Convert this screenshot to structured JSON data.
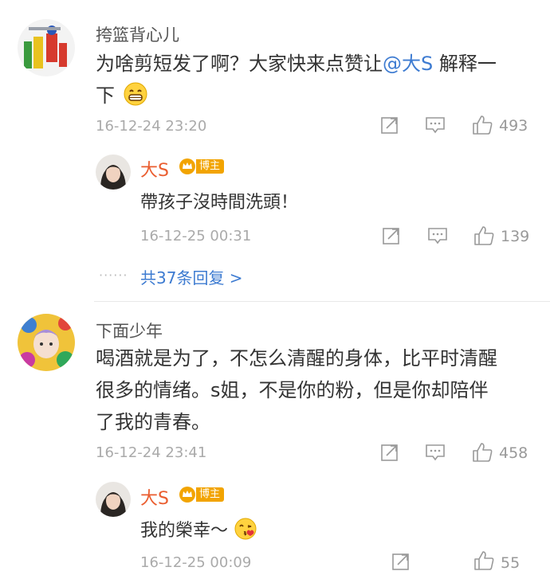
{
  "comments": [
    {
      "username": "挎篮背心儿",
      "content_before": "为啥剪短发了啊？大家快来点赞让",
      "mention": "@大S",
      "content_after": " 解释一",
      "content_line2": "下",
      "time": "16-12-24 23:20",
      "likes": "493",
      "reply": {
        "username": "大S",
        "badge": "博主",
        "content": "帶孩子沒時間洗頭！",
        "time": "16-12-25 00:31",
        "likes": "139"
      },
      "more_replies": "共37条回复 >"
    },
    {
      "username": "下面少年",
      "content_line1": "喝酒就是为了，不怎么清醒的身体，比平时清醒",
      "content_line2": "很多的情绪。s姐，不是你的粉，但是你却陪伴",
      "content_line3": "了我的青春。",
      "time": "16-12-24 23:41",
      "likes": "458",
      "reply": {
        "username": "大S",
        "badge": "博主",
        "content": "我的榮幸～",
        "time": "16-12-25 00:09",
        "likes": "55"
      }
    }
  ],
  "icons": {
    "share": "share-icon",
    "comment": "comment-icon",
    "like": "thumbs-up-icon",
    "grin": "grinning-emoji-icon",
    "kiss": "kissing-emoji-icon",
    "crown": "vip-crown-icon"
  },
  "colors": {
    "name_vip": "#ea5d2f",
    "link": "#3d7bd1",
    "meta": "#aaaaaa",
    "badge": "#f2a400"
  }
}
